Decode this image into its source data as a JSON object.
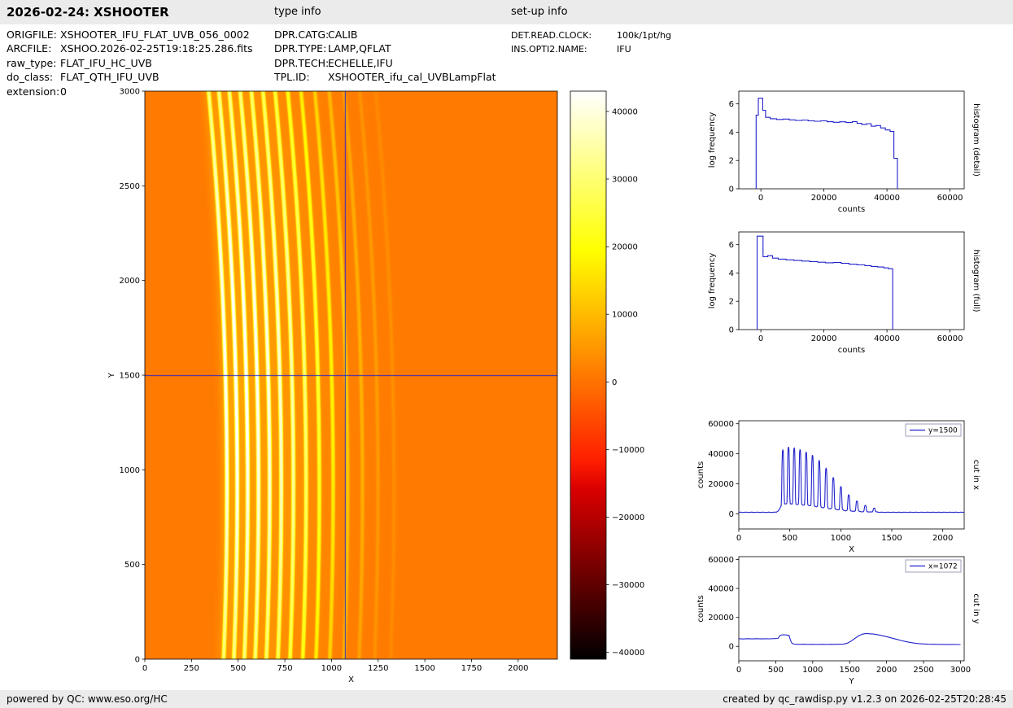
{
  "header": {
    "title": "2026-02-24: XSHOOTER",
    "type_info_label": "type info",
    "setup_info_label": "set-up info"
  },
  "metadata": {
    "left": [
      {
        "label": "ORIGFILE:",
        "value": "XSHOOTER_IFU_FLAT_UVB_056_0002"
      },
      {
        "label": "ARCFILE:",
        "value": "XSHOO.2026-02-25T19:18:25.286.fits"
      },
      {
        "label": "raw_type:",
        "value": "FLAT_IFU_HC_UVB"
      },
      {
        "label": "do_class:",
        "value": "FLAT_QTH_IFU_UVB"
      },
      {
        "label": "extension:",
        "value": "0"
      }
    ],
    "middle": [
      {
        "label": "DPR.CATG:",
        "value": "CALIB"
      },
      {
        "label": "DPR.TYPE:",
        "value": "LAMP,QFLAT"
      },
      {
        "label": "DPR.TECH:",
        "value": "ECHELLE,IFU"
      },
      {
        "label": "TPL.ID:",
        "value": "XSHOOTER_ifu_cal_UVBLampFlat"
      }
    ],
    "right": [
      {
        "label": "DET.READ.CLOCK:",
        "value": "100k/1pt/hg"
      },
      {
        "label": "INS.OPTI2.NAME:",
        "value": "IFU"
      }
    ]
  },
  "footer": {
    "left_prefix": "powered by QC: ",
    "left_link": "www.eso.org/HC",
    "right": "created by qc_rawdisp.py v1.2.3 on 2026-02-25T20:28:45"
  },
  "chart_data": [
    {
      "id": "main_image",
      "type": "heatmap",
      "title": "",
      "xlabel": "X",
      "ylabel": "Y",
      "xlim": [
        0,
        2210
      ],
      "ylim": [
        0,
        3000
      ],
      "xticks": [
        0,
        250,
        500,
        750,
        1000,
        1250,
        1500,
        1750,
        2000
      ],
      "yticks": [
        0,
        500,
        1000,
        1500,
        2000,
        2500,
        3000
      ],
      "colormap": "hot",
      "vmin": -41000,
      "vmax": 43000,
      "background_counts": 1100,
      "order_sigma": 9,
      "order_curve": {
        "linear": 120,
        "quad": -200
      },
      "crosshair": {
        "x": 1072,
        "y": 1500,
        "color": "#2222cc"
      },
      "orders": [
        {
          "x_bottom": 422,
          "amplitude": 41000
        },
        {
          "x_bottom": 477,
          "amplitude": 42500
        },
        {
          "x_bottom": 533,
          "amplitude": 42000
        },
        {
          "x_bottom": 591,
          "amplitude": 41000
        },
        {
          "x_bottom": 651,
          "amplitude": 39500
        },
        {
          "x_bottom": 713,
          "amplitude": 37500
        },
        {
          "x_bottom": 778,
          "amplitude": 34000
        },
        {
          "x_bottom": 846,
          "amplitude": 29000
        },
        {
          "x_bottom": 917,
          "amplitude": 23000
        },
        {
          "x_bottom": 991,
          "amplitude": 17000
        },
        {
          "x_bottom": 1068,
          "amplitude": 11500
        },
        {
          "x_bottom": 1148,
          "amplitude": 7500
        },
        {
          "x_bottom": 1231,
          "amplitude": 4500
        },
        {
          "x_bottom": 1317,
          "amplitude": 2800
        }
      ]
    },
    {
      "id": "colorbar",
      "type": "colorbar",
      "colormap": "hot",
      "vmin": -41000,
      "vmax": 43000,
      "ticks": [
        40000,
        30000,
        20000,
        10000,
        0,
        -10000,
        -20000,
        -30000,
        -40000
      ]
    },
    {
      "id": "hist_detail",
      "type": "line",
      "xlabel": "counts",
      "ylabel": "log frequency",
      "side_label": "histogram (detail)",
      "legend": "",
      "color": "#2222cc",
      "xlim": [
        -7000,
        64500
      ],
      "ylim": [
        0,
        6.9
      ],
      "xticks": [
        0,
        20000,
        40000,
        60000
      ],
      "yticks": [
        0,
        2,
        4,
        6
      ],
      "points": [
        [
          -1500,
          0
        ],
        [
          -1500,
          5.2
        ],
        [
          -800,
          5.2
        ],
        [
          -800,
          6.4
        ],
        [
          600,
          6.4
        ],
        [
          600,
          5.55
        ],
        [
          1500,
          5.55
        ],
        [
          1500,
          5.05
        ],
        [
          3000,
          5.05
        ],
        [
          3000,
          4.95
        ],
        [
          5000,
          4.95
        ],
        [
          5000,
          4.9
        ],
        [
          7000,
          4.9
        ],
        [
          7000,
          4.93
        ],
        [
          9000,
          4.93
        ],
        [
          9000,
          4.87
        ],
        [
          11000,
          4.87
        ],
        [
          11000,
          4.83
        ],
        [
          13000,
          4.83
        ],
        [
          13000,
          4.86
        ],
        [
          15000,
          4.86
        ],
        [
          15000,
          4.8
        ],
        [
          17000,
          4.8
        ],
        [
          17000,
          4.77
        ],
        [
          19000,
          4.77
        ],
        [
          19000,
          4.8
        ],
        [
          21000,
          4.8
        ],
        [
          21000,
          4.74
        ],
        [
          23000,
          4.74
        ],
        [
          23000,
          4.7
        ],
        [
          25000,
          4.7
        ],
        [
          25000,
          4.73
        ],
        [
          27000,
          4.73
        ],
        [
          27000,
          4.68
        ],
        [
          29000,
          4.68
        ],
        [
          29000,
          4.75
        ],
        [
          30500,
          4.75
        ],
        [
          30500,
          4.63
        ],
        [
          32000,
          4.63
        ],
        [
          32000,
          4.55
        ],
        [
          33500,
          4.55
        ],
        [
          33500,
          4.6
        ],
        [
          35000,
          4.6
        ],
        [
          35000,
          4.42
        ],
        [
          36500,
          4.42
        ],
        [
          36500,
          4.47
        ],
        [
          38000,
          4.47
        ],
        [
          38000,
          4.3
        ],
        [
          39500,
          4.3
        ],
        [
          39500,
          4.16
        ],
        [
          41000,
          4.16
        ],
        [
          41000,
          4.05
        ],
        [
          42200,
          4.05
        ],
        [
          42200,
          2.15
        ],
        [
          43300,
          2.15
        ],
        [
          43300,
          0
        ]
      ]
    },
    {
      "id": "hist_full",
      "type": "line",
      "xlabel": "counts",
      "ylabel": "log frequency",
      "side_label": "histogram (full)",
      "legend": "",
      "color": "#2222cc",
      "xlim": [
        -7000,
        64500
      ],
      "ylim": [
        0,
        6.9
      ],
      "xticks": [
        0,
        20000,
        40000,
        60000
      ],
      "yticks": [
        0,
        2,
        4,
        6
      ],
      "points": [
        [
          -1200,
          0
        ],
        [
          -1200,
          6.6
        ],
        [
          700,
          6.6
        ],
        [
          700,
          5.15
        ],
        [
          2200,
          5.15
        ],
        [
          2200,
          5.22
        ],
        [
          3700,
          5.22
        ],
        [
          3700,
          5.05
        ],
        [
          5500,
          5.05
        ],
        [
          5500,
          4.98
        ],
        [
          8000,
          4.98
        ],
        [
          8000,
          4.93
        ],
        [
          10500,
          4.93
        ],
        [
          10500,
          4.88
        ],
        [
          13000,
          4.88
        ],
        [
          13000,
          4.84
        ],
        [
          15500,
          4.84
        ],
        [
          15500,
          4.8
        ],
        [
          18000,
          4.8
        ],
        [
          18000,
          4.76
        ],
        [
          20500,
          4.76
        ],
        [
          20500,
          4.72
        ],
        [
          23000,
          4.72
        ],
        [
          23000,
          4.74
        ],
        [
          25500,
          4.74
        ],
        [
          25500,
          4.68
        ],
        [
          28000,
          4.68
        ],
        [
          28000,
          4.62
        ],
        [
          30500,
          4.62
        ],
        [
          30500,
          4.57
        ],
        [
          33000,
          4.57
        ],
        [
          33000,
          4.52
        ],
        [
          35000,
          4.52
        ],
        [
          35000,
          4.46
        ],
        [
          37000,
          4.46
        ],
        [
          37000,
          4.42
        ],
        [
          39000,
          4.42
        ],
        [
          39000,
          4.36
        ],
        [
          40500,
          4.36
        ],
        [
          40500,
          4.3
        ],
        [
          41800,
          4.3
        ],
        [
          41800,
          0
        ]
      ]
    },
    {
      "id": "cut_x",
      "type": "line",
      "xlabel": "X",
      "ylabel": "counts",
      "side_label": "cut in x",
      "legend": "y=1500",
      "color": "#2222cc",
      "xlim": [
        0,
        2210
      ],
      "ylim": [
        -10000,
        62000
      ],
      "xticks": [
        0,
        500,
        1000,
        1500,
        2000
      ],
      "yticks": [
        0,
        20000,
        40000,
        60000
      ],
      "derived_from": "main_image profile at y=1500"
    },
    {
      "id": "cut_y",
      "type": "line",
      "xlabel": "Y",
      "ylabel": "counts",
      "side_label": "cut in y",
      "legend": "x=1072",
      "color": "#2222cc",
      "xlim": [
        0,
        3050
      ],
      "ylim": [
        -10000,
        62000
      ],
      "xticks": [
        0,
        500,
        1000,
        1500,
        2000,
        2500,
        3000
      ],
      "yticks": [
        0,
        20000,
        40000,
        60000
      ],
      "points": [
        [
          0,
          5300
        ],
        [
          60,
          5100
        ],
        [
          120,
          5300
        ],
        [
          180,
          5150
        ],
        [
          240,
          5300
        ],
        [
          300,
          5150
        ],
        [
          360,
          5250
        ],
        [
          420,
          5200
        ],
        [
          480,
          5350
        ],
        [
          530,
          5450
        ],
        [
          560,
          7600
        ],
        [
          600,
          8000
        ],
        [
          640,
          7900
        ],
        [
          680,
          7500
        ],
        [
          700,
          4000
        ],
        [
          720,
          2000
        ],
        [
          760,
          1500
        ],
        [
          820,
          1350
        ],
        [
          880,
          1450
        ],
        [
          940,
          1300
        ],
        [
          1000,
          1400
        ],
        [
          1060,
          1300
        ],
        [
          1120,
          1420
        ],
        [
          1180,
          1320
        ],
        [
          1240,
          1400
        ],
        [
          1300,
          1350
        ],
        [
          1360,
          1450
        ],
        [
          1420,
          1600
        ],
        [
          1470,
          2200
        ],
        [
          1520,
          3600
        ],
        [
          1570,
          5400
        ],
        [
          1620,
          7200
        ],
        [
          1670,
          8400
        ],
        [
          1720,
          8900
        ],
        [
          1770,
          8700
        ],
        [
          1820,
          8500
        ],
        [
          1870,
          8100
        ],
        [
          1920,
          7600
        ],
        [
          1970,
          7000
        ],
        [
          2020,
          6400
        ],
        [
          2080,
          5600
        ],
        [
          2140,
          4800
        ],
        [
          2200,
          4000
        ],
        [
          2260,
          3300
        ],
        [
          2320,
          2700
        ],
        [
          2380,
          2200
        ],
        [
          2440,
          1850
        ],
        [
          2500,
          1650
        ],
        [
          2560,
          1500
        ],
        [
          2620,
          1420
        ],
        [
          2700,
          1350
        ],
        [
          2800,
          1300
        ],
        [
          2900,
          1280
        ],
        [
          3000,
          1260
        ]
      ]
    }
  ]
}
